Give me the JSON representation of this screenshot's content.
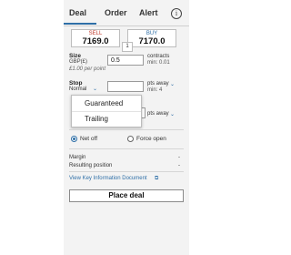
{
  "tabs": [
    {
      "label": "Deal"
    },
    {
      "label": "Order"
    },
    {
      "label": "Alert"
    }
  ],
  "info_icon": "i",
  "prices": {
    "sell_label": "SELL",
    "sell_value": "7169.0",
    "buy_label": "BUY",
    "buy_value": "7170.0",
    "spread": "1"
  },
  "size": {
    "label": "Size",
    "currency": "GBP(£)",
    "note": "£1.00 per point",
    "value": "0.5",
    "unit": "contracts",
    "min": "min: 0.01"
  },
  "stop": {
    "label": "Stop",
    "type": "Normal",
    "chevron": "⌄",
    "unit": "pts away",
    "unit_chevron": "⌄",
    "min": "min: 4"
  },
  "limit": {
    "unit": "pts away",
    "unit_chevron": "⌄"
  },
  "stop_type_menu": [
    "Guaranteed",
    "Trailing"
  ],
  "options": {
    "net_off": "Net off",
    "force_open": "Force open",
    "selected": "Net off"
  },
  "summary": {
    "margin_label": "Margin",
    "margin_value": "-",
    "resulting_label": "Resulting position",
    "resulting_value": "-"
  },
  "kid": {
    "link": "View Key Information Document",
    "icon": "⧉"
  },
  "place_deal": "Place deal",
  "colors": {
    "accent": "#2f6fa7",
    "sell": "#c0392b",
    "panel_bg": "#f3f3f3"
  }
}
